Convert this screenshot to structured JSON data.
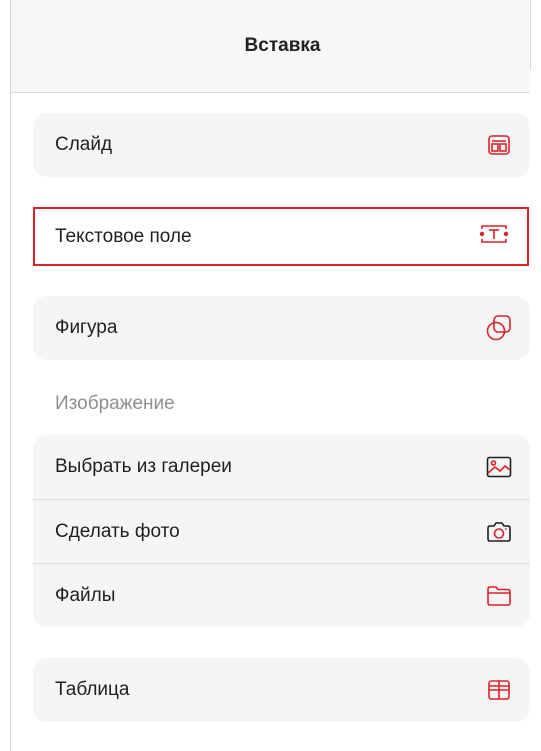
{
  "header": {
    "title": "Вставка"
  },
  "items": {
    "slide": "Слайд",
    "text_field": "Текстовое поле",
    "shape": "Фигура"
  },
  "image_section": {
    "label": "Изображение",
    "gallery": "Выбрать из галереи",
    "photo": "Сделать фото",
    "files": "Файлы"
  },
  "table": {
    "label": "Таблица"
  },
  "icons": {
    "slide": "slide-layout-icon",
    "text_field": "text-box-icon",
    "shape": "shape-icon",
    "gallery": "image-gallery-icon",
    "photo": "camera-icon",
    "files": "folder-icon",
    "table": "table-icon"
  },
  "colors": {
    "accent": "#d8232a"
  }
}
